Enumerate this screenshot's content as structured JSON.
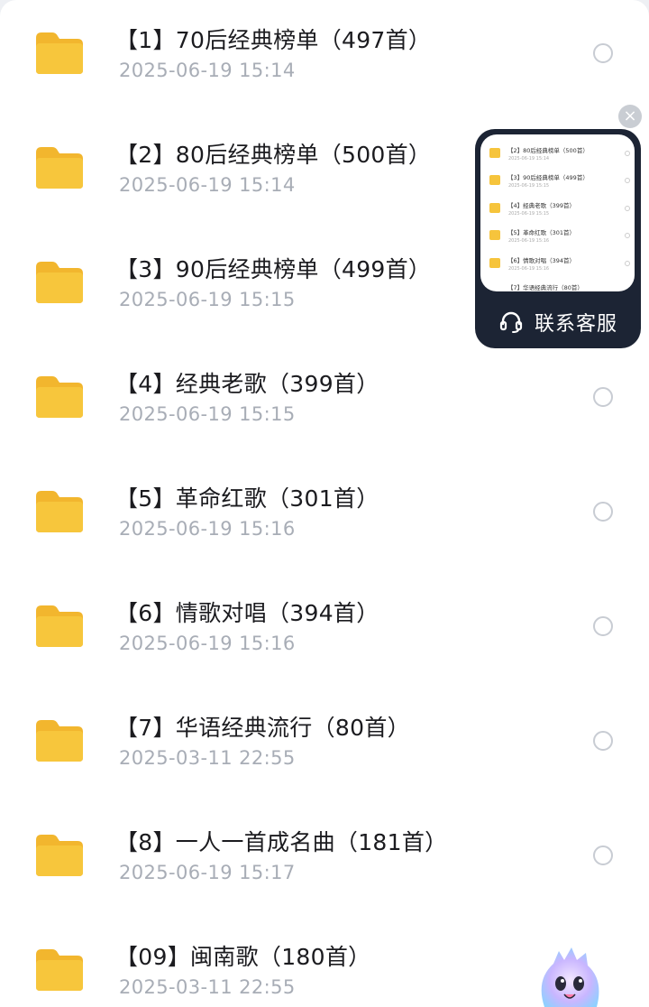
{
  "files": [
    {
      "title": "【1】70后经典榜单（497首）",
      "date": "2025-06-19  15:14"
    },
    {
      "title": "【2】80后经典榜单（500首）",
      "date": "2025-06-19  15:14"
    },
    {
      "title": "【3】90后经典榜单（499首）",
      "date": "2025-06-19  15:15"
    },
    {
      "title": "【4】经典老歌（399首）",
      "date": "2025-06-19  15:15"
    },
    {
      "title": "【5】革命红歌（301首）",
      "date": "2025-06-19  15:16"
    },
    {
      "title": "【6】情歌对唱（394首）",
      "date": "2025-06-19  15:16"
    },
    {
      "title": "【7】华语经典流行（80首）",
      "date": "2025-03-11  22:55"
    },
    {
      "title": "【8】一人一首成名曲（181首）",
      "date": "2025-06-19  15:17"
    },
    {
      "title": "【09】闽南歌（180首）",
      "date": "2025-03-11  22:55"
    }
  ],
  "customer_service": {
    "label": "联系客服",
    "close_glyph": "×",
    "preview_rows": [
      {
        "title": "【2】80后经典榜单（500首）",
        "date": "2025-06-19  15:14"
      },
      {
        "title": "【3】90后经典榜单（499首）",
        "date": "2025-06-19  15:15"
      },
      {
        "title": "【4】经典老歌（399首）",
        "date": "2025-06-19  15:15"
      },
      {
        "title": "【5】革命红歌（301首）",
        "date": "2025-06-19  15:16"
      },
      {
        "title": "【6】情歌对唱（394首）",
        "date": "2025-06-19  15:16"
      },
      {
        "title": "【7】华语经典流行（80首）",
        "date": ""
      }
    ]
  },
  "icons": {
    "folder": "folder-icon",
    "radio": "select-radio",
    "headset": "headset-icon",
    "close": "close-icon",
    "mascot": "assistant-mascot-icon"
  },
  "colors": {
    "folder": "#f7c63c",
    "folder_tab": "#f2b62e",
    "title_text": "#1b1b1f",
    "date_text": "#a8adb6",
    "widget_bg": "#1c2434"
  }
}
